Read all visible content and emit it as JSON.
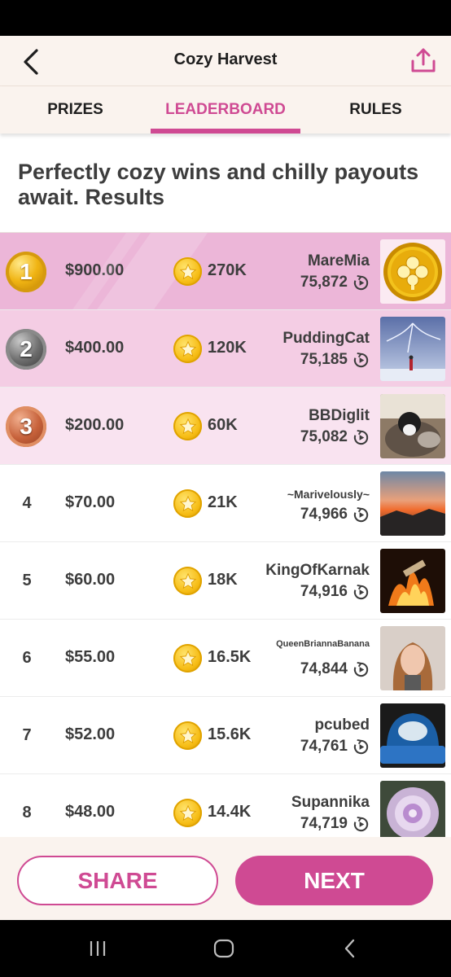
{
  "header": {
    "title": "Cozy Harvest"
  },
  "tabs": [
    {
      "label": "PRIZES",
      "active": false
    },
    {
      "label": "LEADERBOARD",
      "active": true
    },
    {
      "label": "RULES",
      "active": false
    }
  ],
  "intro": "Perfectly cozy wins and chilly payouts await. Results",
  "leaderboard": [
    {
      "rank": "1",
      "prize": "$900.00",
      "coins": "270K",
      "name": "MareMia",
      "score": "75,872",
      "medal": "gold"
    },
    {
      "rank": "2",
      "prize": "$400.00",
      "coins": "120K",
      "name": "PuddingCat",
      "score": "75,185",
      "medal": "silver"
    },
    {
      "rank": "3",
      "prize": "$200.00",
      "coins": "60K",
      "name": "BBDiglit",
      "score": "75,082",
      "medal": "bronze"
    },
    {
      "rank": "4",
      "prize": "$70.00",
      "coins": "21K",
      "name": "~Marivelously~",
      "score": "74,966"
    },
    {
      "rank": "5",
      "prize": "$60.00",
      "coins": "18K",
      "name": "KingOfKarnak",
      "score": "74,916"
    },
    {
      "rank": "6",
      "prize": "$55.00",
      "coins": "16.5K",
      "name": "QueenBriannaBanana",
      "score": "74,844"
    },
    {
      "rank": "7",
      "prize": "$52.00",
      "coins": "15.6K",
      "name": "pcubed",
      "score": "74,761"
    },
    {
      "rank": "8",
      "prize": "$48.00",
      "coins": "14.4K",
      "name": "Supannika",
      "score": "74,719"
    }
  ],
  "buttons": {
    "share": "SHARE",
    "next": "NEXT"
  },
  "colors": {
    "accent": "#cf4a93",
    "row1": "#ecb6d8",
    "row2": "#f4cde4",
    "row3": "#f9e3f0",
    "panel": "#faf3ee"
  },
  "icons": {
    "back": "chevron-left-icon",
    "share": "share-upload-icon",
    "coin": "star-coin-icon",
    "replay": "replay-icon"
  }
}
